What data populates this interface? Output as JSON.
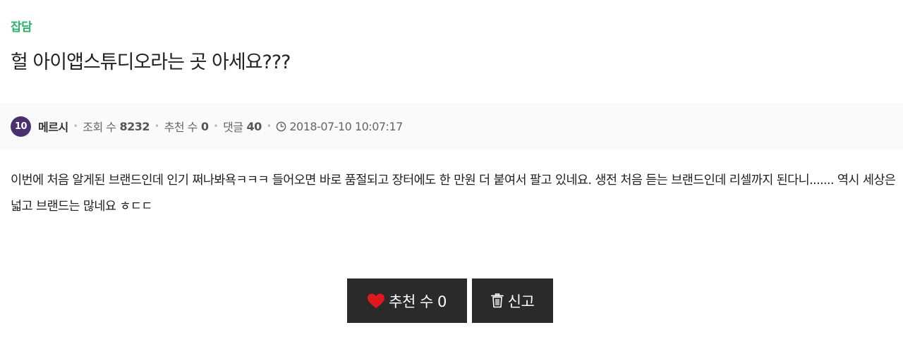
{
  "post": {
    "category": "잡담",
    "title": "헐 아이앱스튜디오라는 곳 아세요???",
    "author": {
      "level": "10",
      "name": "메르시"
    },
    "stats": {
      "views_label": "조회 수",
      "views": "8232",
      "recommend_label": "추천 수",
      "recommend": "0",
      "comments_label": "댓글",
      "comments": "40",
      "datetime": "2018-07-10 10:07:17"
    },
    "content": "이번에 처음 알게된 브랜드인데 인기 쩌나봐욕ㅋㅋㅋ 들어오면 바로 품절되고 장터에도 한 만원 더 붙여서 팔고 있네요. 생전 처음 듣는 브랜드인데 리셀까지 된다니....... 역시 세상은 넓고 브랜드는 많네요 ㅎㄷㄷ"
  },
  "actions": {
    "recommend_label": "추천 수 0",
    "report_label": "신고"
  },
  "colors": {
    "category": "#2bb56b",
    "badge": "#4b3070",
    "button_bg": "#2a2a2a",
    "heart": "#e0181f"
  },
  "icons": [
    "clock-icon",
    "heart-icon",
    "trash-icon"
  ]
}
